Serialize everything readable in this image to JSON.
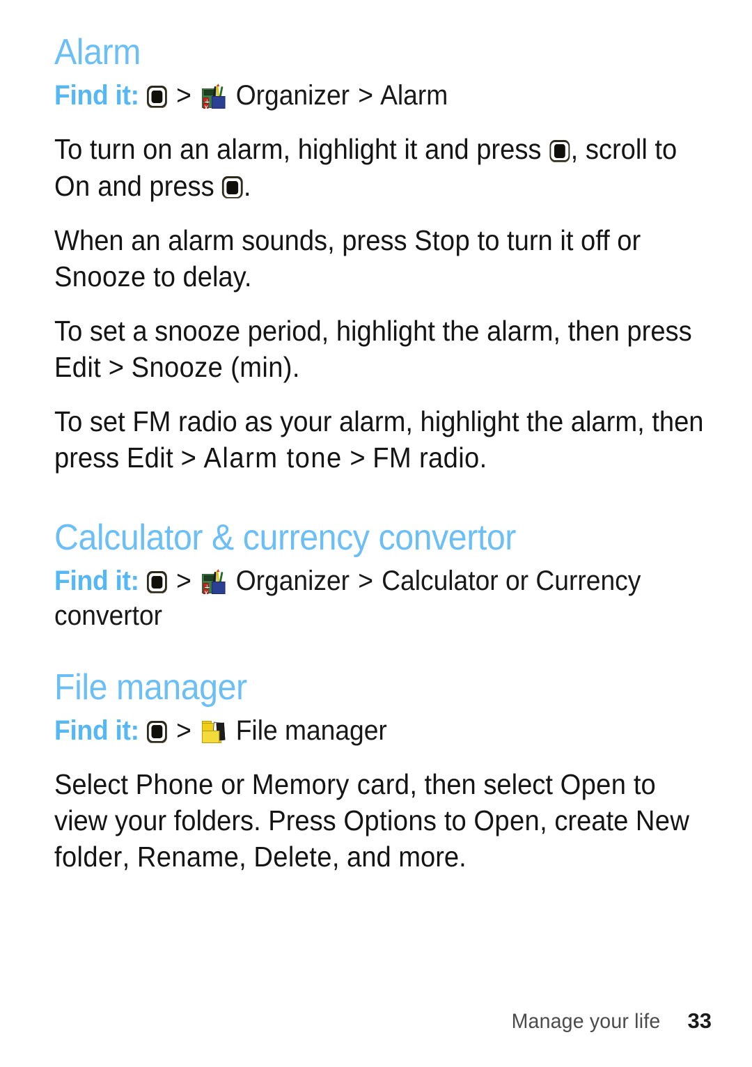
{
  "page": {
    "background_color": "#ffffff",
    "heading_color": "#6cbff5",
    "findit_label_color": "#55b7f4",
    "body_text_color": "#141414"
  },
  "sections": [
    {
      "id": "alarm",
      "title": "Alarm",
      "findit": {
        "label": "Find it:",
        "key_icon": "center-key-icon",
        "sep1": ">",
        "app_icon": "organizer-icon",
        "app": "Organizer",
        "sep2": ">",
        "target": "Alarm"
      },
      "paragraphs": [
        {
          "id": "turn-on-alarm",
          "parts": [
            {
              "type": "text",
              "value": "To turn on an alarm, highlight it and press "
            },
            {
              "type": "icon",
              "value": "center-key-icon"
            },
            {
              "type": "text",
              "value": ", scroll to "
            },
            {
              "type": "ui",
              "value": "On"
            },
            {
              "type": "text",
              "value": " and press "
            },
            {
              "type": "icon",
              "value": "center-key-icon"
            },
            {
              "type": "text",
              "value": "."
            }
          ]
        },
        {
          "id": "alarm-sounds",
          "parts": [
            {
              "type": "text",
              "value": "When an alarm sounds, press "
            },
            {
              "type": "ui",
              "value": "Stop"
            },
            {
              "type": "text",
              "value": " to turn it off or "
            },
            {
              "type": "ui",
              "value": "Snooze"
            },
            {
              "type": "text",
              "value": " to delay."
            }
          ]
        },
        {
          "id": "snooze-period",
          "parts": [
            {
              "type": "text",
              "value": "To set a snooze period, highlight the alarm, then press "
            },
            {
              "type": "ui",
              "value": "Edit"
            },
            {
              "type": "text",
              "value": " > "
            },
            {
              "type": "ui",
              "value": "Snooze (min)"
            },
            {
              "type": "text",
              "value": "."
            }
          ]
        },
        {
          "id": "fm-radio-alarm",
          "parts": [
            {
              "type": "text",
              "value": "To set FM radio as your alarm, highlight the alarm, then press "
            },
            {
              "type": "ui",
              "value": "Edit"
            },
            {
              "type": "text",
              "value": " > "
            },
            {
              "type": "ui-wide",
              "value": "Alarm tone"
            },
            {
              "type": "text",
              "value": " > "
            },
            {
              "type": "ui",
              "value": "FM radio"
            },
            {
              "type": "text",
              "value": "."
            }
          ]
        }
      ]
    },
    {
      "id": "calculator",
      "title": "Calculator & currency convertor",
      "findit": {
        "label": "Find it:",
        "key_icon": "center-key-icon",
        "sep1": ">",
        "app_icon": "organizer-icon",
        "app": "Organizer",
        "sep2": ">",
        "target": "Calculator",
        "conjunction": "or",
        "target_alt": "Currency convertor"
      },
      "paragraphs": []
    },
    {
      "id": "file-manager",
      "title": "File manager",
      "findit": {
        "label": "Find it:",
        "key_icon": "center-key-icon",
        "sep1": ">",
        "app_icon": "file-manager-icon",
        "target": "File manager"
      },
      "paragraphs": [
        {
          "id": "file-manager-usage",
          "parts": [
            {
              "type": "text",
              "value": "Select "
            },
            {
              "type": "ui",
              "value": "Phone"
            },
            {
              "type": "text",
              "value": " or "
            },
            {
              "type": "ui",
              "value": "Memory card"
            },
            {
              "type": "text",
              "value": ", then select "
            },
            {
              "type": "ui",
              "value": "Open"
            },
            {
              "type": "text",
              "value": " to view your folders. Press "
            },
            {
              "type": "ui",
              "value": "Options"
            },
            {
              "type": "text",
              "value": " to "
            },
            {
              "type": "ui",
              "value": "Open"
            },
            {
              "type": "text",
              "value": ", create "
            },
            {
              "type": "ui",
              "value": "New folder"
            },
            {
              "type": "text",
              "value": ", "
            },
            {
              "type": "ui",
              "value": "Rename"
            },
            {
              "type": "text",
              "value": ", "
            },
            {
              "type": "ui",
              "value": "Delete"
            },
            {
              "type": "text",
              "value": ", and more."
            }
          ]
        }
      ]
    }
  ],
  "footer": {
    "chapter": "Manage your life",
    "page_number": "33"
  },
  "icons": {
    "center_key": "center-key-icon",
    "organizer": "organizer-icon",
    "file_manager": "file-manager-icon",
    "calc_button_plus": "+",
    "calc_button_times": "x"
  }
}
